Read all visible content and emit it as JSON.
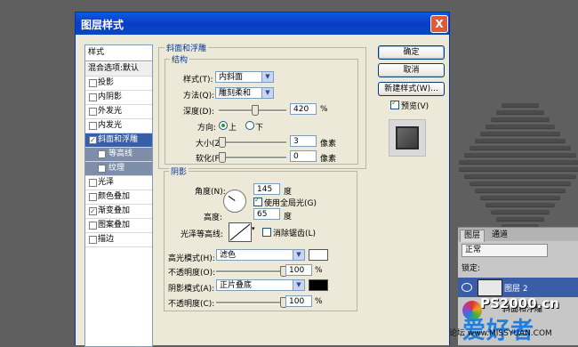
{
  "dialog": {
    "title": "图层样式",
    "close_glyph": "X"
  },
  "styles_list": {
    "header": "样式",
    "blend_options": "混合选项:默认",
    "items": [
      {
        "label": "投影",
        "checked": false
      },
      {
        "label": "内阴影",
        "checked": false
      },
      {
        "label": "外发光",
        "checked": false
      },
      {
        "label": "内发光",
        "checked": false
      },
      {
        "label": "斜面和浮雕",
        "checked": true
      },
      {
        "label": "等高线",
        "checked": false
      },
      {
        "label": "纹理",
        "checked": false
      },
      {
        "label": "光泽",
        "checked": false
      },
      {
        "label": "颜色叠加",
        "checked": false
      },
      {
        "label": "渐变叠加",
        "checked": true
      },
      {
        "label": "图案叠加",
        "checked": false
      },
      {
        "label": "描边",
        "checked": false
      }
    ]
  },
  "bevel": {
    "section": "斜面和浮雕",
    "structure": {
      "legend": "结构",
      "style_label": "样式(T):",
      "style_value": "内斜面",
      "technique_label": "方法(Q):",
      "technique_value": "雕刻柔和",
      "depth_label": "深度(D):",
      "depth_value": "420",
      "percent": "%",
      "direction_label": "方向:",
      "direction_up": "上",
      "direction_down": "下",
      "direction_selected": "上",
      "size_label": "大小(Z):",
      "size_value": "3",
      "soften_label": "软化(F):",
      "soften_value": "0",
      "px_unit": "像素"
    },
    "shading": {
      "legend": "阴影",
      "angle_label": "角度(N):",
      "angle_value": "145",
      "degree": "度",
      "global_light_label": "使用全局光(G)",
      "global_light_checked": true,
      "altitude_label": "高度:",
      "altitude_value": "65",
      "gloss_label": "光泽等高线:",
      "antialias_label": "消除锯齿(L)",
      "antialias_checked": false,
      "highlight_mode_label": "高光模式(H):",
      "highlight_mode_value": "滤色",
      "highlight_color": "#ffffff",
      "opacity_label": "不透明度(O):",
      "highlight_opacity": "100",
      "shadow_mode_label": "阴影模式(A):",
      "shadow_mode_value": "正片叠底",
      "shadow_color": "#000000",
      "opacity2_label": "不透明度(C):",
      "shadow_opacity": "100",
      "percent": "%"
    }
  },
  "buttons": {
    "ok": "确定",
    "cancel": "取消",
    "new_style": "新建样式(W)...",
    "preview_label": "预览(V)",
    "preview_checked": true
  },
  "layers_panel": {
    "tabs": [
      "图层",
      "通道"
    ],
    "blend_mode": "正常",
    "lock_label": "锁定:",
    "layer_name": "图层 2",
    "effect_label": "斜面和浮雕"
  },
  "watermark": {
    "site": "思缘设计论坛  www.MISSYUAN.COM",
    "brand": "PS2000.cn",
    "brand2": "爱好者"
  }
}
